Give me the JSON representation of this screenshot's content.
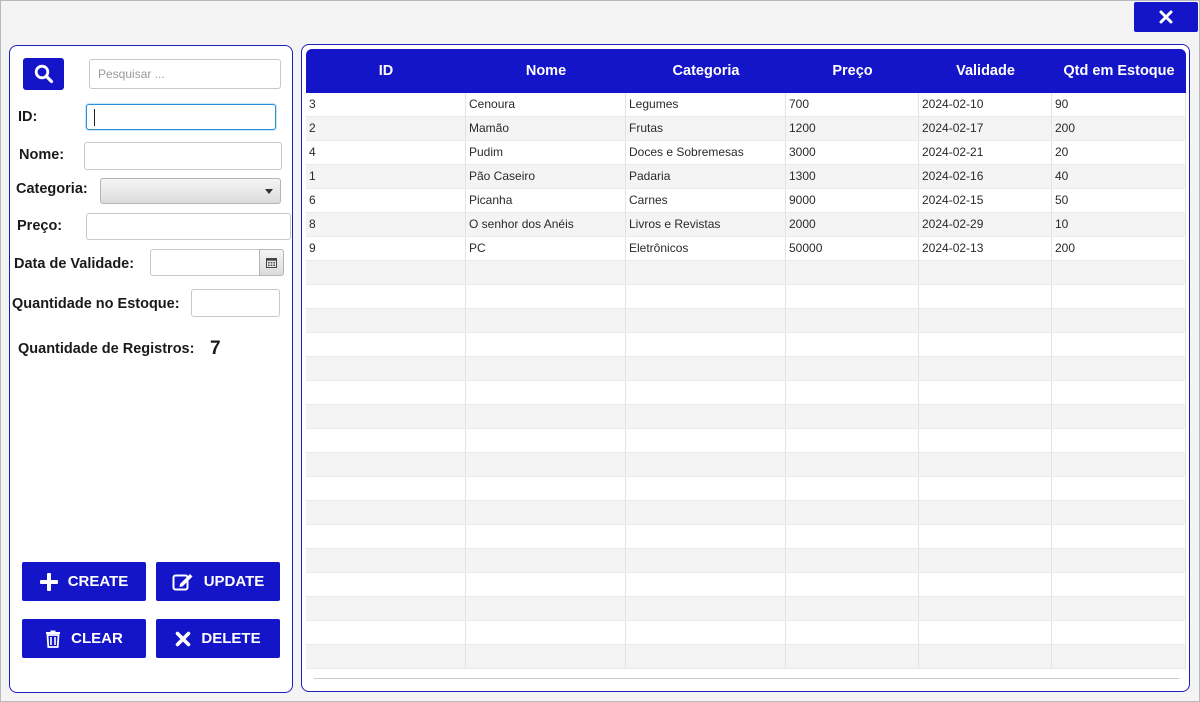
{
  "window": {
    "close_icon": "close-icon"
  },
  "form": {
    "search_placeholder": "Pesquisar ...",
    "id_label": "ID:",
    "id_value": "",
    "nome_label": "Nome:",
    "nome_value": "",
    "categoria_label": "Categoria:",
    "categoria_value": "",
    "preco_label": "Preço:",
    "preco_value": "",
    "validade_label": "Data de Validade:",
    "validade_value": "",
    "estoque_label": "Quantidade no Estoque:",
    "estoque_value": "",
    "registros_label": "Quantidade  de Registros:",
    "registros_count": "7"
  },
  "actions": {
    "create": "CREATE",
    "update": "UPDATE",
    "clear": "CLEAR",
    "delete": "DELETE"
  },
  "table": {
    "columns": [
      "ID",
      "Nome",
      "Categoria",
      "Preço",
      "Validade",
      "Qtd em Estoque"
    ],
    "rows": [
      [
        "3",
        "Cenoura",
        "Legumes",
        "700",
        "2024-02-10",
        "90"
      ],
      [
        "2",
        "Mamão",
        "Frutas",
        "1200",
        "2024-02-17",
        "200"
      ],
      [
        "4",
        "Pudim",
        "Doces e Sobremesas",
        "3000",
        "2024-02-21",
        "20"
      ],
      [
        "1",
        "Pão Caseiro",
        "Padaria",
        "1300",
        "2024-02-16",
        "40"
      ],
      [
        "6",
        "Picanha",
        "Carnes",
        "9000",
        "2024-02-15",
        "50"
      ],
      [
        "8",
        "O senhor dos Anéis",
        "Livros e Revistas",
        "2000",
        "2024-02-29",
        "10"
      ],
      [
        "9",
        "PC",
        "Eletrônicos",
        "50000",
        "2024-02-13",
        "200"
      ]
    ]
  },
  "colors": {
    "accent": "#1414c8",
    "panel_border": "#1e1ebe",
    "focus": "#2a8fd6"
  }
}
